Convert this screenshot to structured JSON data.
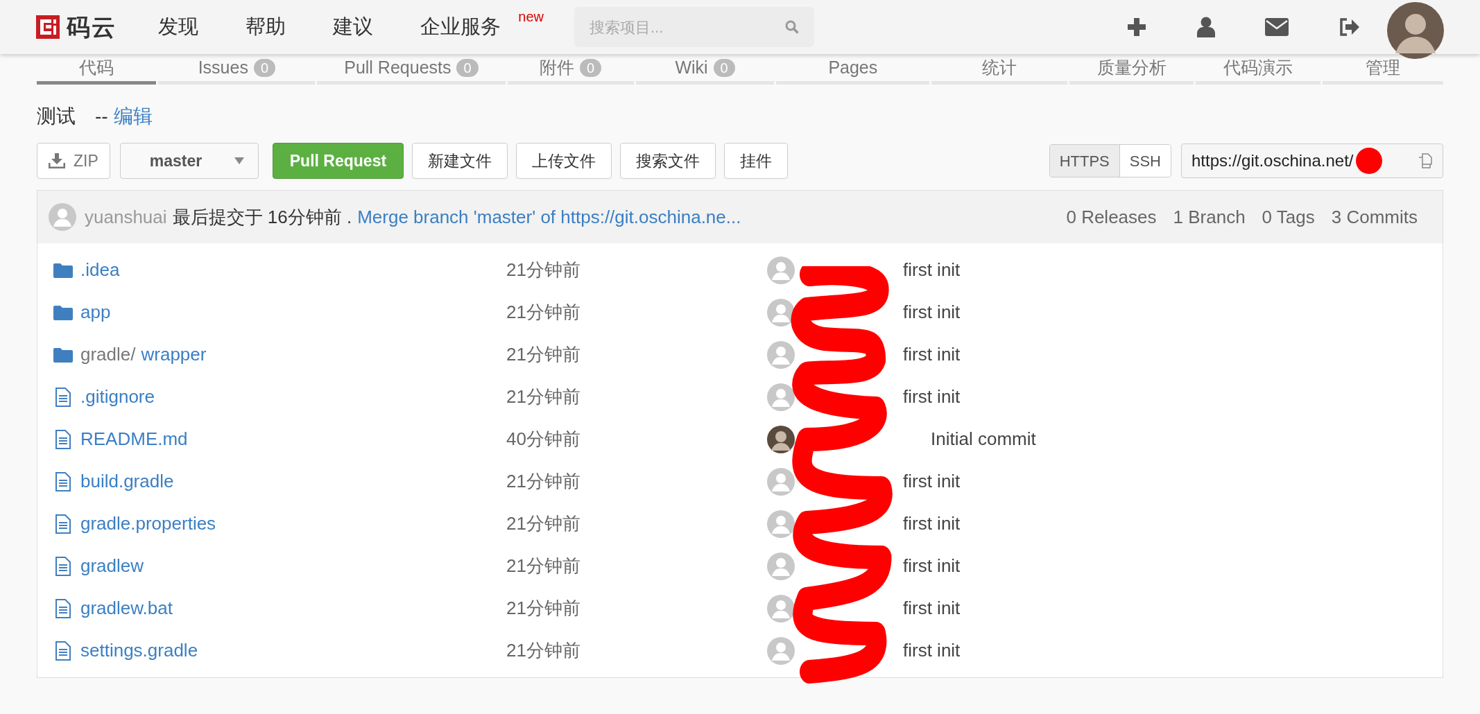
{
  "header": {
    "logo": "码云",
    "nav": [
      {
        "label": "发现"
      },
      {
        "label": "帮助"
      },
      {
        "label": "建议"
      },
      {
        "label": "企业服务",
        "badge": "new"
      }
    ],
    "search": {
      "placeholder": "搜索项目..."
    }
  },
  "tabs": [
    {
      "label": "代码",
      "selected": true
    },
    {
      "label": "Issues",
      "count": "0",
      "selected": false
    },
    {
      "label": "Pull Requests",
      "count": "0",
      "selected": false
    },
    {
      "label": "附件",
      "count": "0",
      "selected": false
    },
    {
      "label": "Wiki",
      "count": "0",
      "selected": false
    },
    {
      "label": "Pages",
      "selected": false
    },
    {
      "label": "统计",
      "selected": false
    },
    {
      "label": "质量分析",
      "selected": false
    },
    {
      "label": "代码演示",
      "selected": false
    },
    {
      "label": "管理",
      "selected": false
    }
  ],
  "repo": {
    "title": "测试",
    "separator": "--",
    "edit_link": "编辑"
  },
  "toolbar": {
    "zip": "ZIP",
    "branch": "master",
    "buttons": [
      {
        "label": "Pull Request",
        "kind": "primary"
      },
      {
        "label": "新建文件",
        "kind": "default"
      },
      {
        "label": "上传文件",
        "kind": "default"
      },
      {
        "label": "搜索文件",
        "kind": "default"
      },
      {
        "label": "挂件",
        "kind": "default"
      }
    ],
    "protocols": [
      {
        "label": "HTTPS",
        "selected": true
      },
      {
        "label": "SSH",
        "selected": false
      }
    ],
    "clone_url": "https://git.oschina.net/"
  },
  "commit_bar": {
    "author": "yuanshuai",
    "text": "最后提交于 16分钟前 .",
    "message": "Merge branch 'master' of https://git.oschina.ne...",
    "stats": [
      "0 Releases",
      "1 Branch",
      "0 Tags",
      "3 Commits"
    ]
  },
  "files": [
    {
      "kind": "folder",
      "name": ".idea",
      "time": "21分钟前",
      "photo_avatar": false,
      "message": "first init"
    },
    {
      "kind": "folder",
      "name": "app",
      "time": "21分钟前",
      "photo_avatar": false,
      "message": "first init"
    },
    {
      "kind": "folder",
      "prefix": "gradle/",
      "name": "wrapper",
      "time": "21分钟前",
      "photo_avatar": false,
      "message": "first init"
    },
    {
      "kind": "file",
      "name": ".gitignore",
      "time": "21分钟前",
      "photo_avatar": false,
      "message": "first init"
    },
    {
      "kind": "file",
      "name": "README.md",
      "time": "40分钟前",
      "photo_avatar": true,
      "message": "Initial commit"
    },
    {
      "kind": "file",
      "name": "build.gradle",
      "time": "21分钟前",
      "photo_avatar": false,
      "message": "first init"
    },
    {
      "kind": "file",
      "name": "gradle.properties",
      "time": "21分钟前",
      "photo_avatar": false,
      "message": "first init"
    },
    {
      "kind": "file",
      "name": "gradlew",
      "time": "21分钟前",
      "photo_avatar": false,
      "message": "first init"
    },
    {
      "kind": "file",
      "name": "gradlew.bat",
      "time": "21分钟前",
      "photo_avatar": false,
      "message": "first init"
    },
    {
      "kind": "file",
      "name": "settings.gradle",
      "time": "21分钟前",
      "photo_avatar": false,
      "message": "first init"
    }
  ]
}
